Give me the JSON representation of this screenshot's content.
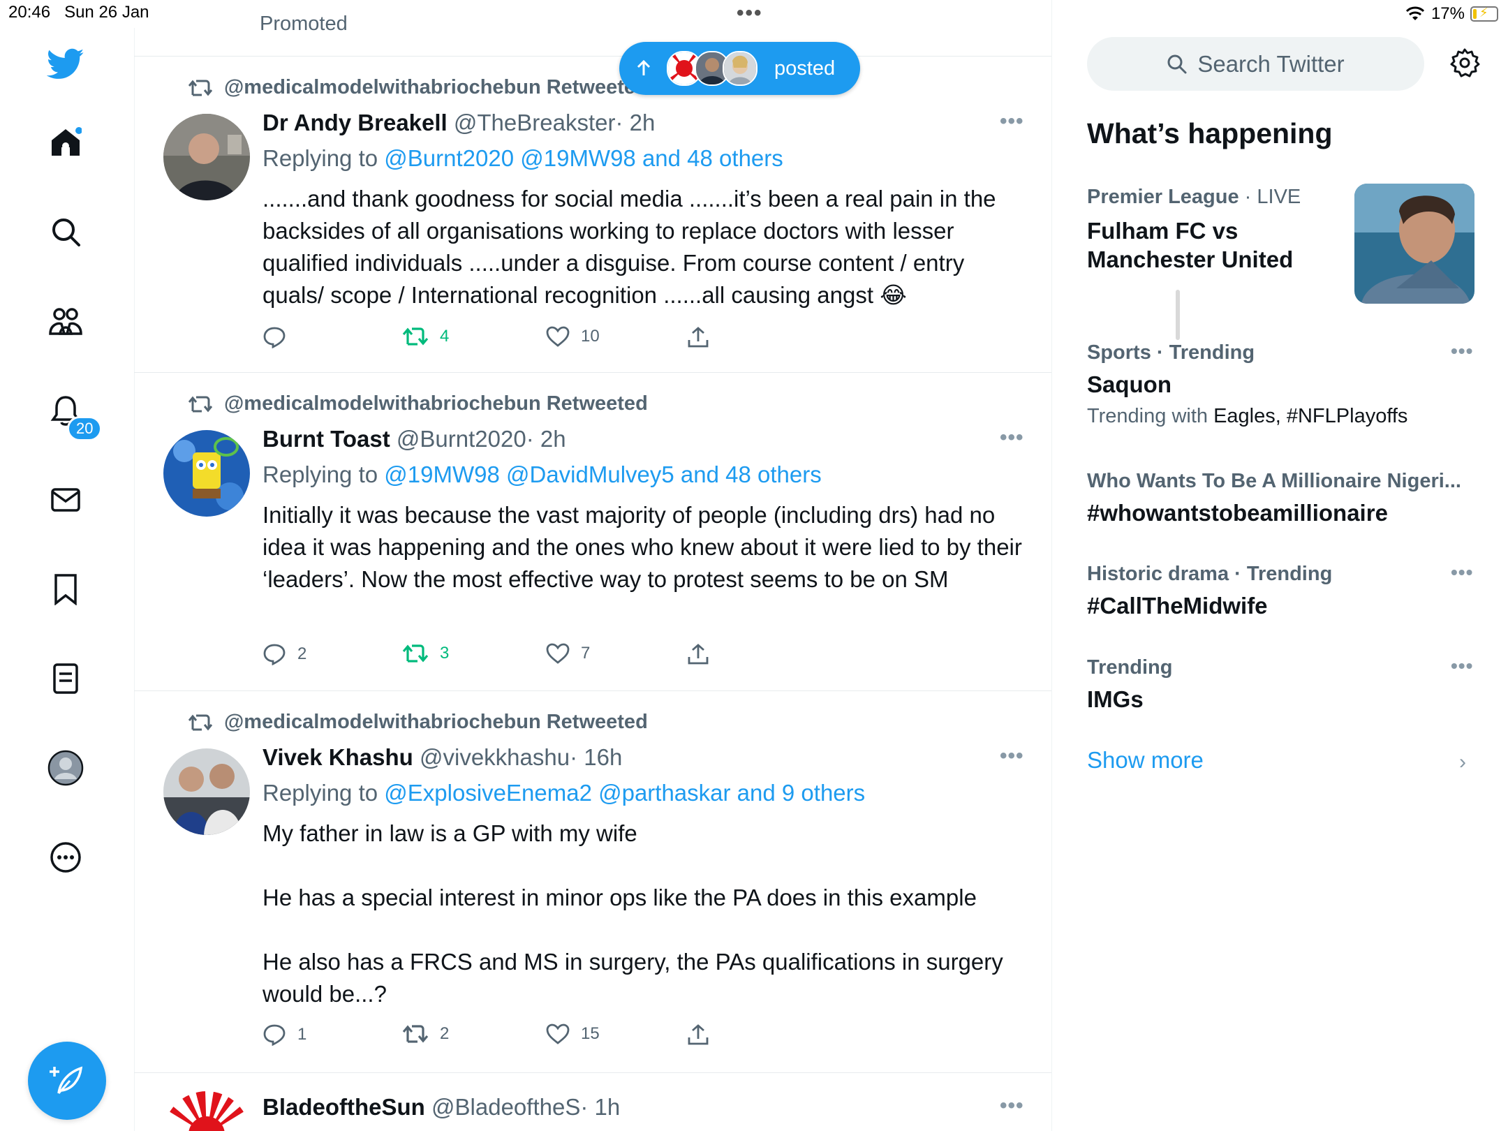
{
  "status_bar": {
    "time": "20:46",
    "date": "Sun 26 Jan",
    "battery": "17%",
    "battery_fraction": 0.17
  },
  "nav": {
    "notifications_badge": "20"
  },
  "pill": {
    "label": "posted"
  },
  "promoted_cut": "Promoted",
  "tweets": [
    {
      "retweeted_by": "@medicalmodelwithabriochebun Retweeted",
      "name": "Dr Andy Breakell",
      "handle": "@TheBreakster",
      "time": "· 2h",
      "reply_prefix": "Replying to",
      "reply_to": "@Burnt2020 @19MW98 and 48 others",
      "text": ".......and thank goodness for social media .......it’s been a real pain in the backsides of all organisations working to replace doctors with lesser qualified individuals .....under a disguise. From course content / entry quals/ scope / International recognition ......all causing angst 😂",
      "replies": "",
      "retweets": "4",
      "likes": "10"
    },
    {
      "retweeted_by": "@medicalmodelwithabriochebun Retweeted",
      "name": "Burnt Toast",
      "handle": "@Burnt2020",
      "time": "· 2h",
      "reply_prefix": "Replying to",
      "reply_to": "@19MW98 @DavidMulvey5 and 48 others",
      "text": "Initially it was because the vast majority of people (including drs) had no idea it was happening and the ones who knew about it were lied to by their ‘leaders’. Now the most effective way to protest seems to be on SM",
      "replies": "2",
      "retweets": "3",
      "likes": "7"
    },
    {
      "retweeted_by": "@medicalmodelwithabriochebun Retweeted",
      "name": "Vivek Khashu",
      "handle": "@vivekkhashu",
      "time": "· 16h",
      "reply_prefix": "Replying to",
      "reply_to": "@ExplosiveEnema2 @parthaskar and 9 others",
      "text": "My father in law is a GP with my wife\n\nHe has a special interest in minor ops like the PA does in this example\n\nHe also has a FRCS and MS in surgery, the PAs qualifications in surgery would be...?",
      "replies": "1",
      "retweets": "2",
      "likes": "15"
    },
    {
      "name": "BladeoftheSun",
      "handle": "@BladeoftheS",
      "time": "· 1h"
    }
  ],
  "right": {
    "search_placeholder": "Search Twitter",
    "section_title": "What’s happening",
    "trends": [
      {
        "meta_bold": "Premier League",
        "meta": " · LIVE",
        "title": "Fulham FC vs\nManchester United"
      },
      {
        "meta_bold": "Sports · Trending",
        "meta": "",
        "title": "Saquon",
        "sub_prefix": "Trending with ",
        "sub_dark": "Eagles, #NFLPlayoffs"
      },
      {
        "meta_bold": "Who Wants To Be A Millionaire Nigeri...",
        "meta": "",
        "title": "#whowantstobeamillionaire"
      },
      {
        "meta_bold": "Historic drama · Trending",
        "meta": "",
        "title": "#CallTheMidwife"
      },
      {
        "meta_bold": "Trending",
        "meta": "",
        "title": "IMGs"
      }
    ],
    "show_more": "Show more"
  },
  "colors": {
    "accent": "#1d9bf0",
    "retweet_green": "#00ba7c",
    "muted": "#536471",
    "text": "#0f1419"
  },
  "icons": [
    "twitter-bird-icon",
    "home-icon",
    "search-icon",
    "communities-icon",
    "bell-icon",
    "mail-icon",
    "bookmark-icon",
    "lists-icon",
    "profile-icon",
    "more-circle-icon",
    "compose-icon",
    "settings-gear-icon",
    "retweet-icon",
    "reply-icon",
    "like-icon",
    "share-icon"
  ]
}
